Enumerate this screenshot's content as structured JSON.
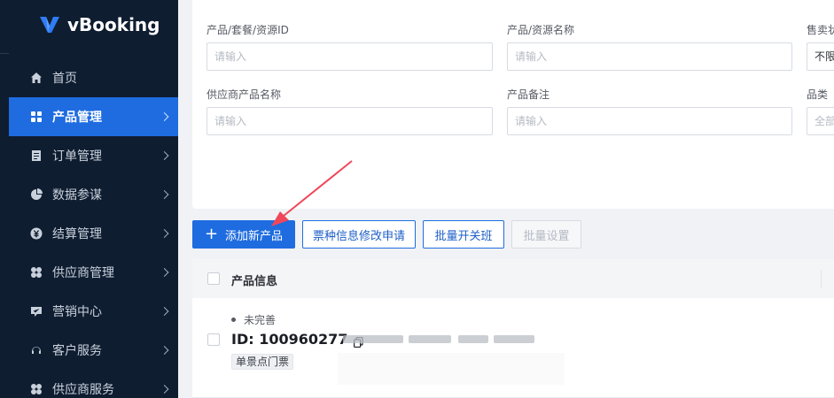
{
  "app": {
    "name": "vBooking",
    "brand_color": "#1e6ce0",
    "sidebar_bg": "#0f1d31"
  },
  "sidebar": {
    "items": [
      {
        "label": "首页",
        "icon": "home-icon",
        "active": false,
        "has_children": false
      },
      {
        "label": "产品管理",
        "icon": "product-icon",
        "active": true,
        "has_children": true
      },
      {
        "label": "订单管理",
        "icon": "order-icon",
        "active": false,
        "has_children": true
      },
      {
        "label": "数据参谋",
        "icon": "pie-chart-icon",
        "active": false,
        "has_children": true
      },
      {
        "label": "结算管理",
        "icon": "yen-icon",
        "active": false,
        "has_children": true
      },
      {
        "label": "供应商管理",
        "icon": "supplier-icon",
        "active": false,
        "has_children": true
      },
      {
        "label": "营销中心",
        "icon": "marketing-icon",
        "active": false,
        "has_children": true
      },
      {
        "label": "客户服务",
        "icon": "headset-icon",
        "active": false,
        "has_children": true
      },
      {
        "label": "供应商服务",
        "icon": "supplier-service-icon",
        "active": false,
        "has_children": true
      }
    ]
  },
  "filters": {
    "product_id": {
      "label": "产品/套餐/资源ID",
      "placeholder": "请输入"
    },
    "product_name": {
      "label": "产品/资源名称",
      "placeholder": "请输入"
    },
    "sale_status": {
      "label": "售卖状",
      "value": "不限"
    },
    "supplier_product_name": {
      "label": "供应商产品名称",
      "placeholder": "请输入"
    },
    "product_note": {
      "label": "产品备注",
      "placeholder": "请输入"
    },
    "category": {
      "label": "品类",
      "value": "全部"
    }
  },
  "actions": {
    "add_product": "添加新产品",
    "ticket_change_request": "票种信息修改申请",
    "batch_toggle_schedule": "批量开关班",
    "batch_settings": "批量设置"
  },
  "table": {
    "header": {
      "product_info": "产品信息"
    },
    "rows": [
      {
        "status": "未完善",
        "id_text": "ID: 100960277",
        "tag": "单景点门票"
      }
    ]
  }
}
